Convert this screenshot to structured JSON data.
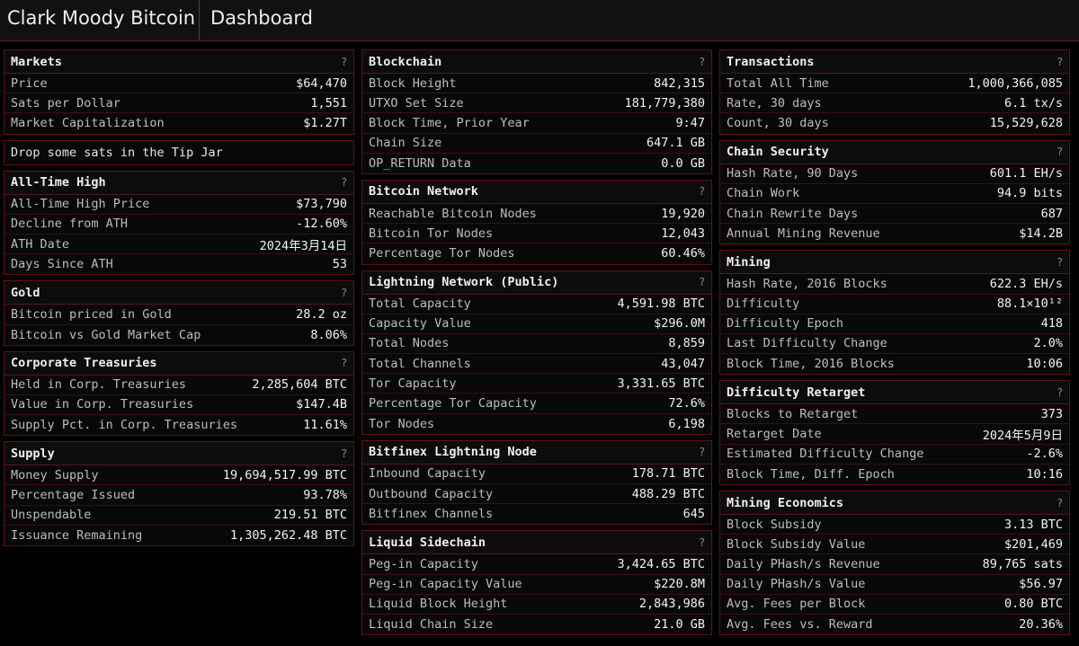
{
  "header": {
    "brand": "Clark Moody Bitcoin",
    "title": "Dashboard"
  },
  "tip_jar": "Drop some sats in the Tip Jar",
  "help_icon": "?",
  "columns": [
    [
      {
        "title": "Markets",
        "rows": [
          {
            "label": "Price",
            "value": "$64,470"
          },
          {
            "label": "Sats per Dollar",
            "value": "1,551"
          },
          {
            "label": "Market Capitalization",
            "value": "$1.27T"
          }
        ]
      },
      {
        "title": "All-Time High",
        "rows": [
          {
            "label": "All-Time High Price",
            "value": "$73,790"
          },
          {
            "label": "Decline from ATH",
            "value": "-12.60%"
          },
          {
            "label": "ATH Date",
            "value": "2024年3月14日"
          },
          {
            "label": "Days Since ATH",
            "value": "53"
          }
        ]
      },
      {
        "title": "Gold",
        "rows": [
          {
            "label": "Bitcoin priced in Gold",
            "value": "28.2 oz"
          },
          {
            "label": "Bitcoin vs Gold Market Cap",
            "value": "8.06%"
          }
        ]
      },
      {
        "title": "Corporate Treasuries",
        "rows": [
          {
            "label": "Held in Corp. Treasuries",
            "value": "2,285,604 BTC"
          },
          {
            "label": "Value in Corp. Treasuries",
            "value": "$147.4B"
          },
          {
            "label": "Supply Pct. in Corp. Treasuries",
            "value": "11.61%"
          }
        ]
      },
      {
        "title": "Supply",
        "rows": [
          {
            "label": "Money Supply",
            "value": "19,694,517.99 BTC"
          },
          {
            "label": "Percentage Issued",
            "value": "93.78%"
          },
          {
            "label": "Unspendable",
            "value": "219.51 BTC"
          },
          {
            "label": "Issuance Remaining",
            "value": "1,305,262.48 BTC"
          }
        ]
      }
    ],
    [
      {
        "title": "Blockchain",
        "rows": [
          {
            "label": "Block Height",
            "value": "842,315"
          },
          {
            "label": "UTXO Set Size",
            "value": "181,779,380"
          },
          {
            "label": "Block Time, Prior Year",
            "value": "9:47"
          },
          {
            "label": "Chain Size",
            "value": "647.1 GB"
          },
          {
            "label": "OP_RETURN Data",
            "value": "0.0 GB"
          }
        ]
      },
      {
        "title": "Bitcoin Network",
        "rows": [
          {
            "label": "Reachable Bitcoin Nodes",
            "value": "19,920"
          },
          {
            "label": "Bitcoin Tor Nodes",
            "value": "12,043"
          },
          {
            "label": "Percentage Tor Nodes",
            "value": "60.46%"
          }
        ]
      },
      {
        "title": "Lightning Network (Public)",
        "rows": [
          {
            "label": "Total Capacity",
            "value": "4,591.98 BTC"
          },
          {
            "label": "Capacity Value",
            "value": "$296.0M"
          },
          {
            "label": "Total Nodes",
            "value": "8,859"
          },
          {
            "label": "Total Channels",
            "value": "43,047"
          },
          {
            "label": "Tor Capacity",
            "value": "3,331.65 BTC"
          },
          {
            "label": "Percentage Tor Capacity",
            "value": "72.6%"
          },
          {
            "label": "Tor Nodes",
            "value": "6,198"
          }
        ]
      },
      {
        "title": "Bitfinex Lightning Node",
        "rows": [
          {
            "label": "Inbound Capacity",
            "value": "178.71 BTC"
          },
          {
            "label": "Outbound Capacity",
            "value": "488.29 BTC"
          },
          {
            "label": "Bitfinex Channels",
            "value": "645"
          }
        ]
      },
      {
        "title": "Liquid Sidechain",
        "rows": [
          {
            "label": "Peg-in Capacity",
            "value": "3,424.65 BTC"
          },
          {
            "label": "Peg-in Capacity Value",
            "value": "$220.8M"
          },
          {
            "label": "Liquid Block Height",
            "value": "2,843,986"
          },
          {
            "label": "Liquid Chain Size",
            "value": "21.0 GB"
          }
        ]
      }
    ],
    [
      {
        "title": "Transactions",
        "rows": [
          {
            "label": "Total All Time",
            "value": "1,000,366,085"
          },
          {
            "label": "Rate, 30 days",
            "value": "6.1 tx/s"
          },
          {
            "label": "Count, 30 days",
            "value": "15,529,628"
          }
        ]
      },
      {
        "title": "Chain Security",
        "rows": [
          {
            "label": "Hash Rate, 90 Days",
            "value": "601.1 EH/s"
          },
          {
            "label": "Chain Work",
            "value": "94.9 bits"
          },
          {
            "label": "Chain Rewrite Days",
            "value": "687"
          },
          {
            "label": "Annual Mining Revenue",
            "value": "$14.2B"
          }
        ]
      },
      {
        "title": "Mining",
        "rows": [
          {
            "label": "Hash Rate, 2016 Blocks",
            "value": "622.3 EH/s"
          },
          {
            "label": "Difficulty",
            "value": "88.1×10¹²"
          },
          {
            "label": "Difficulty Epoch",
            "value": "418"
          },
          {
            "label": "Last Difficulty Change",
            "value": "2.0%"
          },
          {
            "label": "Block Time, 2016 Blocks",
            "value": "10:06"
          }
        ]
      },
      {
        "title": "Difficulty Retarget",
        "rows": [
          {
            "label": "Blocks to Retarget",
            "value": "373"
          },
          {
            "label": "Retarget Date",
            "value": "2024年5月9日"
          },
          {
            "label": "Estimated Difficulty Change",
            "value": "-2.6%"
          },
          {
            "label": "Block Time, Diff. Epoch",
            "value": "10:16"
          }
        ]
      },
      {
        "title": "Mining Economics",
        "rows": [
          {
            "label": "Block Subsidy",
            "value": "3.13 BTC"
          },
          {
            "label": "Block Subsidy Value",
            "value": "$201,469"
          },
          {
            "label": "Daily PHash/s Revenue",
            "value": "89,765 sats"
          },
          {
            "label": "Daily PHash/s Value",
            "value": "$56.97"
          },
          {
            "label": "Avg. Fees per Block",
            "value": "0.80 BTC"
          },
          {
            "label": "Avg. Fees vs. Reward",
            "value": "20.36%"
          }
        ]
      }
    ]
  ]
}
